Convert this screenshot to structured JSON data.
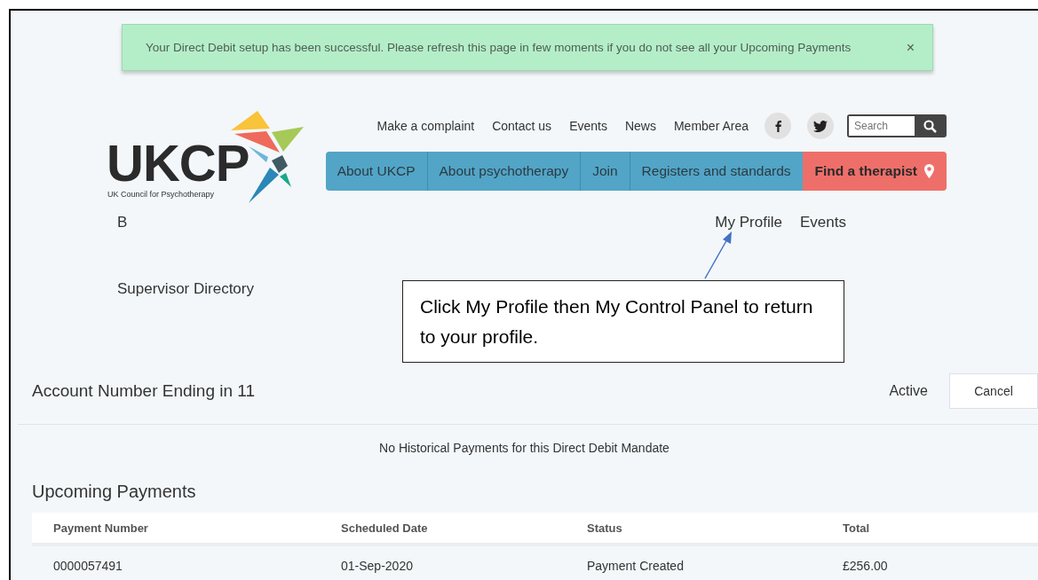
{
  "alert": {
    "message": "Your Direct Debit setup has been successful. Please refresh this page in few moments if you do not see all your Upcoming Payments",
    "close": "×"
  },
  "logo": {
    "wordmark": "UKCP",
    "tagline": "UK Council for Psychotherapy"
  },
  "top_links": [
    "Make a complaint",
    "Contact us",
    "Events",
    "News",
    "Member Area"
  ],
  "search": {
    "placeholder": "Search"
  },
  "nav": [
    {
      "label": "About UKCP",
      "kind": "normal"
    },
    {
      "label": "About psychotherapy",
      "kind": "normal"
    },
    {
      "label": "Join",
      "kind": "normal"
    },
    {
      "label": "Registers and standards",
      "kind": "normal"
    },
    {
      "label": "Find a therapist",
      "kind": "highlight"
    }
  ],
  "sub_left": "B",
  "sub_links": [
    "My Profile",
    "Events"
  ],
  "directory_link": "Supervisor Directory",
  "callout": {
    "text": "Click My Profile then My Control Panel to return to your profile."
  },
  "mandate": {
    "title": "Account Number Ending in 11",
    "status": "Active",
    "cancel": "Cancel"
  },
  "history_message": "No Historical Payments for this Direct Debit Mandate",
  "upcoming": {
    "title": "Upcoming Payments",
    "columns": [
      "Payment Number",
      "Scheduled Date",
      "Status",
      "Total"
    ],
    "rows": [
      [
        "0000057491",
        "01-Sep-2020",
        "Payment Created",
        "£256.00"
      ]
    ]
  }
}
